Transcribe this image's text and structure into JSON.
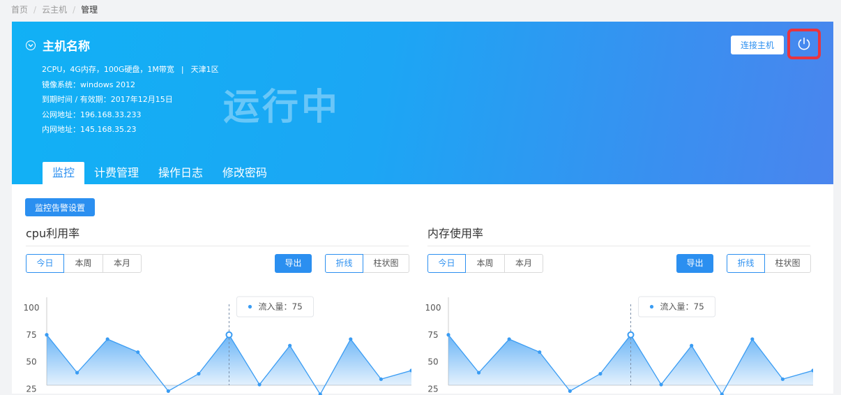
{
  "breadcrumb": {
    "home": "首页",
    "section": "云主机",
    "current": "管理"
  },
  "host": {
    "name": "主机名称",
    "specs": "2CPU，4G内存，100G硬盘，1M带宽",
    "region": "天津1区",
    "image_label": "镜像系统：",
    "image_value": "windows 2012",
    "expire_label": "到期时间 / 有效期：",
    "expire_value": "2017年12月15日",
    "public_label": "公网地址：",
    "public_value": "196.168.33.233",
    "private_label": "内网地址：",
    "private_value": "145.168.35.23",
    "status": "运行中",
    "connect_label": "连接主机"
  },
  "tabs": [
    {
      "label": "监控",
      "active": true
    },
    {
      "label": "计费管理",
      "active": false
    },
    {
      "label": "操作日志",
      "active": false
    },
    {
      "label": "修改密码",
      "active": false
    }
  ],
  "alarm_button": "监控告警设置",
  "controls": {
    "periods": [
      "今日",
      "本周",
      "本月"
    ],
    "export": "导出",
    "types": [
      "折线",
      "柱状图"
    ]
  },
  "colors": {
    "accent": "#2b8ff0",
    "power_highlight": "#e8343f"
  },
  "chart_data": [
    {
      "type": "area",
      "title": "cpu利用率",
      "y_ticks": [
        100,
        75,
        50,
        25
      ],
      "ylim": [
        0,
        100
      ],
      "values": [
        75,
        40,
        71,
        59,
        23,
        39,
        75,
        29,
        65,
        20,
        71,
        34,
        42
      ],
      "tooltip": {
        "index": 6,
        "label": "流入量：75"
      },
      "grid": false
    },
    {
      "type": "area",
      "title": "内存使用率",
      "y_ticks": [
        100,
        75,
        50,
        25
      ],
      "ylim": [
        0,
        100
      ],
      "values": [
        75,
        40,
        71,
        59,
        23,
        39,
        75,
        29,
        65,
        20,
        71,
        34,
        42
      ],
      "tooltip": {
        "index": 6,
        "label": "流入量：75"
      },
      "grid": false
    }
  ]
}
